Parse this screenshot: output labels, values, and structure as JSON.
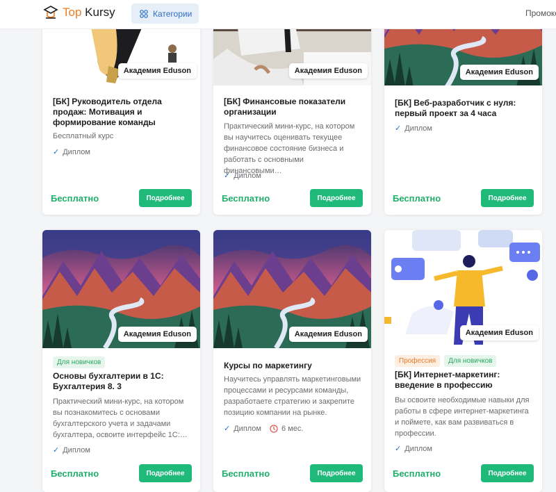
{
  "header": {
    "logo_top": "Top",
    "logo_kursy": "Kursy",
    "categories_label": "Категории",
    "promo_label": "Промокоды"
  },
  "colors": {
    "accent": "#1fb97a",
    "price": "#1fae6b",
    "logo": "#ef7d22",
    "category": "#2e6fc4"
  },
  "cards": [
    {
      "provider": "Академия Eduson",
      "title": "[БК] Руководитель отдела продаж: Мотивация и формирование команды",
      "description": "Бесплатный курс",
      "diploma": "Диплом",
      "price": "Бесплатно",
      "button": "Подробнее"
    },
    {
      "provider": "Академия Eduson",
      "title": "[БК] Финансовые показатели организации",
      "description": "Практический мини-курс, на котором вы научитесь оценивать текущее финансовое состояние бизнеса и работать с основными финансовыми…",
      "diploma": "Диплом",
      "price": "Бесплатно",
      "button": "Подробнее"
    },
    {
      "provider": "Академия Eduson",
      "title": "[БК] Веб-разработчик с нуля: первый проект за 4 часа",
      "diploma": "Диплом",
      "price": "Бесплатно",
      "button": "Подробнее"
    },
    {
      "provider": "Академия Eduson",
      "badges": [
        "Для новичков"
      ],
      "title": "Основы бухгалтерии в 1С: Бухгалтерия 8. 3",
      "description": "Практический мини-курс, на котором вы познакомитесь с основами бухгалтерского учета и задачами бухгалтера, освоите интерфейс 1С:…",
      "diploma": "Диплом",
      "price": "Бесплатно",
      "button": "Подробнее"
    },
    {
      "provider": "Академия Eduson",
      "title": "Курсы по маркетингу",
      "description": "Научитесь управлять маркетинговыми процессами и ресурсами команды, разработаете стратегию и закрепите позицию компании на рынке.",
      "diploma": "Диплом",
      "duration": "6 мес.",
      "price": "Бесплатно",
      "button": "Подробнее"
    },
    {
      "provider": "Академия Eduson",
      "badges": [
        "Профессия",
        "Для новичков"
      ],
      "title": "[БК] Интернет-маркетинг: введение в профессию",
      "description": "Вы освоите необходимые навыки для работы в сфере интернет-маркетинга и поймете, как вам развиваться в профессии.",
      "diploma": "Диплом",
      "price": "Бесплатно",
      "button": "Подробнее"
    }
  ]
}
